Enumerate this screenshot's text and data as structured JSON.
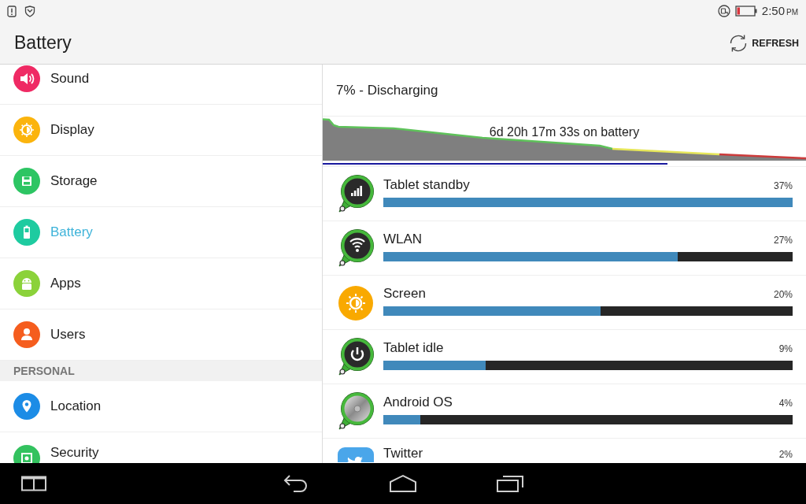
{
  "status_bar": {
    "time": "2:50",
    "period": "PM"
  },
  "header": {
    "title": "Battery",
    "refresh": {
      "label": "REFRESH"
    }
  },
  "sidebar": {
    "groups": [
      {
        "items": [
          {
            "kind": "sound",
            "label": "Sound",
            "selected": false
          },
          {
            "kind": "display",
            "label": "Display",
            "selected": false
          },
          {
            "kind": "storage",
            "label": "Storage",
            "selected": false
          },
          {
            "kind": "battery",
            "label": "Battery",
            "selected": true
          },
          {
            "kind": "apps",
            "label": "Apps",
            "selected": false
          },
          {
            "kind": "users",
            "label": "Users",
            "selected": false
          }
        ]
      },
      {
        "title": "PERSONAL",
        "items": [
          {
            "kind": "location",
            "label": "Location",
            "selected": false
          },
          {
            "kind": "security",
            "label": "Security",
            "selected": false
          }
        ]
      }
    ]
  },
  "battery": {
    "status": "7% - Discharging",
    "history": {
      "label": "6d 20h 17m 33s on battery"
    },
    "usage": [
      {
        "kind": "signal",
        "name": "Tablet standby",
        "percent": "37%",
        "level": 1.0
      },
      {
        "kind": "wifi",
        "name": "WLAN",
        "percent": "27%",
        "level": 0.72
      },
      {
        "kind": "display",
        "name": "Screen",
        "percent": "20%",
        "level": 0.53
      },
      {
        "kind": "power",
        "name": "Tablet idle",
        "percent": "9%",
        "level": 0.25
      },
      {
        "kind": "system",
        "name": "Android OS",
        "percent": "4%",
        "level": 0.09
      },
      {
        "kind": "app",
        "name": "Twitter",
        "percent": "2%"
      }
    ]
  }
}
